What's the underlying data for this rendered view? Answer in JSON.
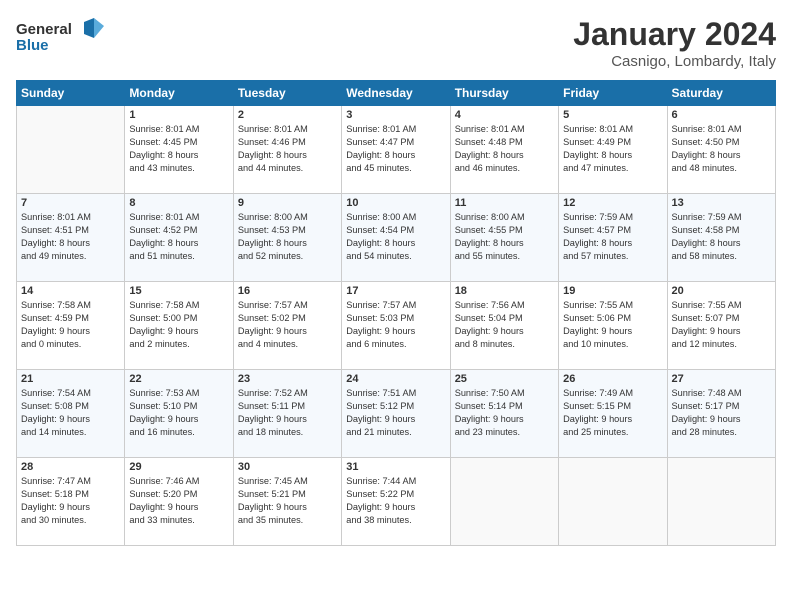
{
  "header": {
    "logo": {
      "line1": "General",
      "line2": "Blue"
    },
    "title": "January 2024",
    "location": "Casnigo, Lombardy, Italy"
  },
  "weekdays": [
    "Sunday",
    "Monday",
    "Tuesday",
    "Wednesday",
    "Thursday",
    "Friday",
    "Saturday"
  ],
  "weeks": [
    [
      {
        "day": "",
        "info": []
      },
      {
        "day": "1",
        "info": [
          "Sunrise: 8:01 AM",
          "Sunset: 4:45 PM",
          "Daylight: 8 hours",
          "and 43 minutes."
        ]
      },
      {
        "day": "2",
        "info": [
          "Sunrise: 8:01 AM",
          "Sunset: 4:46 PM",
          "Daylight: 8 hours",
          "and 44 minutes."
        ]
      },
      {
        "day": "3",
        "info": [
          "Sunrise: 8:01 AM",
          "Sunset: 4:47 PM",
          "Daylight: 8 hours",
          "and 45 minutes."
        ]
      },
      {
        "day": "4",
        "info": [
          "Sunrise: 8:01 AM",
          "Sunset: 4:48 PM",
          "Daylight: 8 hours",
          "and 46 minutes."
        ]
      },
      {
        "day": "5",
        "info": [
          "Sunrise: 8:01 AM",
          "Sunset: 4:49 PM",
          "Daylight: 8 hours",
          "and 47 minutes."
        ]
      },
      {
        "day": "6",
        "info": [
          "Sunrise: 8:01 AM",
          "Sunset: 4:50 PM",
          "Daylight: 8 hours",
          "and 48 minutes."
        ]
      }
    ],
    [
      {
        "day": "7",
        "info": [
          "Sunrise: 8:01 AM",
          "Sunset: 4:51 PM",
          "Daylight: 8 hours",
          "and 49 minutes."
        ]
      },
      {
        "day": "8",
        "info": [
          "Sunrise: 8:01 AM",
          "Sunset: 4:52 PM",
          "Daylight: 8 hours",
          "and 51 minutes."
        ]
      },
      {
        "day": "9",
        "info": [
          "Sunrise: 8:00 AM",
          "Sunset: 4:53 PM",
          "Daylight: 8 hours",
          "and 52 minutes."
        ]
      },
      {
        "day": "10",
        "info": [
          "Sunrise: 8:00 AM",
          "Sunset: 4:54 PM",
          "Daylight: 8 hours",
          "and 54 minutes."
        ]
      },
      {
        "day": "11",
        "info": [
          "Sunrise: 8:00 AM",
          "Sunset: 4:55 PM",
          "Daylight: 8 hours",
          "and 55 minutes."
        ]
      },
      {
        "day": "12",
        "info": [
          "Sunrise: 7:59 AM",
          "Sunset: 4:57 PM",
          "Daylight: 8 hours",
          "and 57 minutes."
        ]
      },
      {
        "day": "13",
        "info": [
          "Sunrise: 7:59 AM",
          "Sunset: 4:58 PM",
          "Daylight: 8 hours",
          "and 58 minutes."
        ]
      }
    ],
    [
      {
        "day": "14",
        "info": [
          "Sunrise: 7:58 AM",
          "Sunset: 4:59 PM",
          "Daylight: 9 hours",
          "and 0 minutes."
        ]
      },
      {
        "day": "15",
        "info": [
          "Sunrise: 7:58 AM",
          "Sunset: 5:00 PM",
          "Daylight: 9 hours",
          "and 2 minutes."
        ]
      },
      {
        "day": "16",
        "info": [
          "Sunrise: 7:57 AM",
          "Sunset: 5:02 PM",
          "Daylight: 9 hours",
          "and 4 minutes."
        ]
      },
      {
        "day": "17",
        "info": [
          "Sunrise: 7:57 AM",
          "Sunset: 5:03 PM",
          "Daylight: 9 hours",
          "and 6 minutes."
        ]
      },
      {
        "day": "18",
        "info": [
          "Sunrise: 7:56 AM",
          "Sunset: 5:04 PM",
          "Daylight: 9 hours",
          "and 8 minutes."
        ]
      },
      {
        "day": "19",
        "info": [
          "Sunrise: 7:55 AM",
          "Sunset: 5:06 PM",
          "Daylight: 9 hours",
          "and 10 minutes."
        ]
      },
      {
        "day": "20",
        "info": [
          "Sunrise: 7:55 AM",
          "Sunset: 5:07 PM",
          "Daylight: 9 hours",
          "and 12 minutes."
        ]
      }
    ],
    [
      {
        "day": "21",
        "info": [
          "Sunrise: 7:54 AM",
          "Sunset: 5:08 PM",
          "Daylight: 9 hours",
          "and 14 minutes."
        ]
      },
      {
        "day": "22",
        "info": [
          "Sunrise: 7:53 AM",
          "Sunset: 5:10 PM",
          "Daylight: 9 hours",
          "and 16 minutes."
        ]
      },
      {
        "day": "23",
        "info": [
          "Sunrise: 7:52 AM",
          "Sunset: 5:11 PM",
          "Daylight: 9 hours",
          "and 18 minutes."
        ]
      },
      {
        "day": "24",
        "info": [
          "Sunrise: 7:51 AM",
          "Sunset: 5:12 PM",
          "Daylight: 9 hours",
          "and 21 minutes."
        ]
      },
      {
        "day": "25",
        "info": [
          "Sunrise: 7:50 AM",
          "Sunset: 5:14 PM",
          "Daylight: 9 hours",
          "and 23 minutes."
        ]
      },
      {
        "day": "26",
        "info": [
          "Sunrise: 7:49 AM",
          "Sunset: 5:15 PM",
          "Daylight: 9 hours",
          "and 25 minutes."
        ]
      },
      {
        "day": "27",
        "info": [
          "Sunrise: 7:48 AM",
          "Sunset: 5:17 PM",
          "Daylight: 9 hours",
          "and 28 minutes."
        ]
      }
    ],
    [
      {
        "day": "28",
        "info": [
          "Sunrise: 7:47 AM",
          "Sunset: 5:18 PM",
          "Daylight: 9 hours",
          "and 30 minutes."
        ]
      },
      {
        "day": "29",
        "info": [
          "Sunrise: 7:46 AM",
          "Sunset: 5:20 PM",
          "Daylight: 9 hours",
          "and 33 minutes."
        ]
      },
      {
        "day": "30",
        "info": [
          "Sunrise: 7:45 AM",
          "Sunset: 5:21 PM",
          "Daylight: 9 hours",
          "and 35 minutes."
        ]
      },
      {
        "day": "31",
        "info": [
          "Sunrise: 7:44 AM",
          "Sunset: 5:22 PM",
          "Daylight: 9 hours",
          "and 38 minutes."
        ]
      },
      {
        "day": "",
        "info": []
      },
      {
        "day": "",
        "info": []
      },
      {
        "day": "",
        "info": []
      }
    ]
  ]
}
